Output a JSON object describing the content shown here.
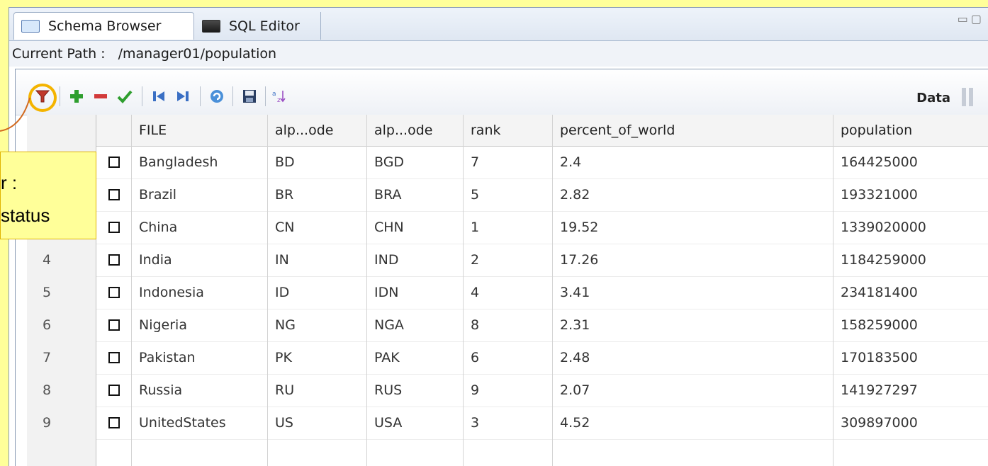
{
  "tabs": [
    {
      "label": "Schema Browser",
      "active": true
    },
    {
      "label": "SQL Editor",
      "active": false
    }
  ],
  "path": {
    "label": "Current Path :",
    "value": "/manager01/population"
  },
  "toolbar": {
    "data_label": "Data"
  },
  "grid": {
    "headers": [
      "FILE",
      "alp...ode",
      "alp...ode",
      "rank",
      "percent_of_world",
      "population"
    ],
    "rows": [
      {
        "num": "",
        "file": "Bangladesh",
        "a2": "BD",
        "a3": "BGD",
        "rank": "7",
        "pct": "2.4",
        "pop": "164425000"
      },
      {
        "num": "",
        "file": "Brazil",
        "a2": "BR",
        "a3": "BRA",
        "rank": "5",
        "pct": "2.82",
        "pop": "193321000"
      },
      {
        "num": "",
        "file": "China",
        "a2": "CN",
        "a3": "CHN",
        "rank": "1",
        "pct": "19.52",
        "pop": "1339020000"
      },
      {
        "num": "4",
        "file": "India",
        "a2": "IN",
        "a3": "IND",
        "rank": "2",
        "pct": "17.26",
        "pop": "1184259000"
      },
      {
        "num": "5",
        "file": "Indonesia",
        "a2": "ID",
        "a3": "IDN",
        "rank": "4",
        "pct": "3.41",
        "pop": "234181400"
      },
      {
        "num": "6",
        "file": "Nigeria",
        "a2": "NG",
        "a3": "NGA",
        "rank": "8",
        "pct": "2.31",
        "pop": "158259000"
      },
      {
        "num": "7",
        "file": "Pakistan",
        "a2": "PK",
        "a3": "PAK",
        "rank": "6",
        "pct": "2.48",
        "pop": "170183500"
      },
      {
        "num": "8",
        "file": "Russia",
        "a2": "RU",
        "a3": "RUS",
        "rank": "9",
        "pct": "2.07",
        "pop": "141927297"
      },
      {
        "num": "9",
        "file": "UnitedStates",
        "a2": "US",
        "a3": "USA",
        "rank": "3",
        "pct": "4.52",
        "pop": "309897000"
      }
    ]
  },
  "callout": {
    "line1": "r :",
    "line2": "status"
  },
  "colors": {
    "accent_ring": "#f4b400",
    "callout_bg": "#ffff99",
    "leader_line": "#d2691e"
  }
}
